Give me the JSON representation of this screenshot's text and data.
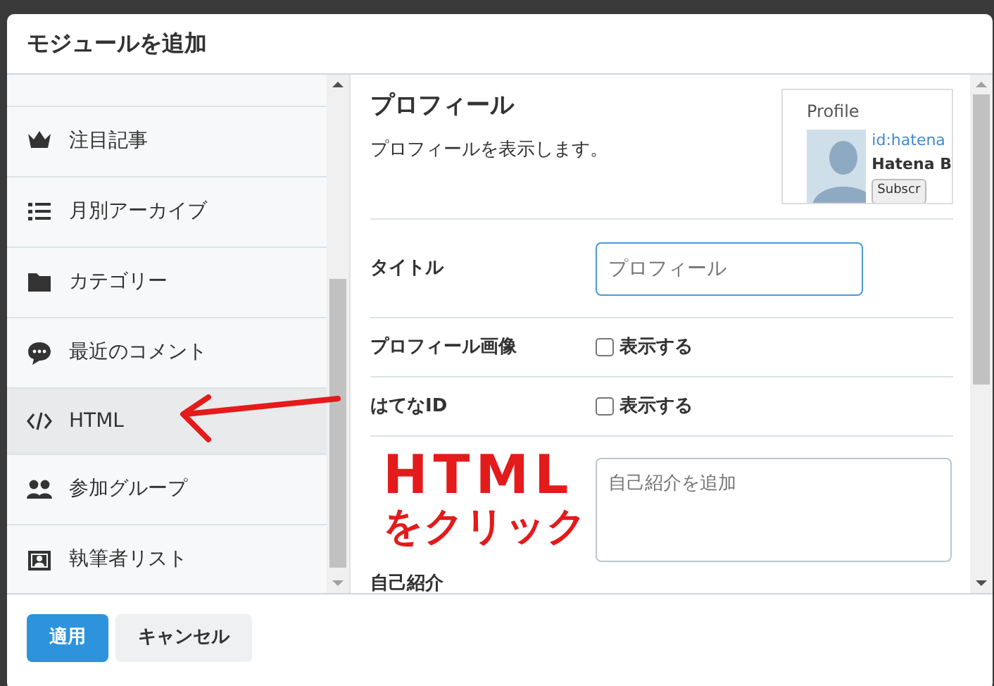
{
  "dialog": {
    "title": "モジュールを追加"
  },
  "modules": [
    {
      "label": "注目記事",
      "selected": false
    },
    {
      "label": "月別アーカイブ",
      "selected": false
    },
    {
      "label": "カテゴリー",
      "selected": false
    },
    {
      "label": "最近のコメント",
      "selected": false
    },
    {
      "label": "HTML",
      "selected": true
    },
    {
      "label": "参加グループ",
      "selected": false
    },
    {
      "label": "執筆者リスト",
      "selected": false
    }
  ],
  "detail": {
    "title": "プロフィール",
    "description": "プロフィールを表示します。",
    "preview": {
      "heading": "Profile",
      "id_link": "id:hatena",
      "name": "Hatena B",
      "button": "Subscr"
    },
    "fields": [
      {
        "kind": "text",
        "label": "タイトル",
        "placeholder": "プロフィール"
      },
      {
        "kind": "checkbox",
        "label": "プロフィール画像",
        "option": "表示する",
        "checked": false
      },
      {
        "kind": "checkbox",
        "label": "はてなID",
        "option": "表示する",
        "checked": false
      },
      {
        "kind": "textarea",
        "label": "自己紹介",
        "placeholder": "自己紹介を追加"
      }
    ]
  },
  "buttons": [
    {
      "label": "適用",
      "primary": true
    },
    {
      "label": "キャンセル",
      "primary": false
    }
  ],
  "annotation": {
    "lines": [
      "HTML",
      "をクリック"
    ]
  }
}
